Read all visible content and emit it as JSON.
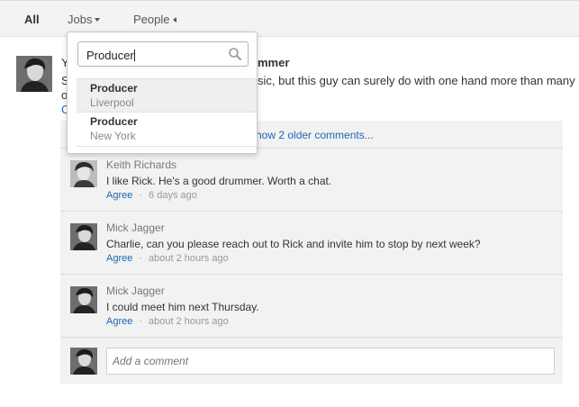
{
  "filters": {
    "all": "All",
    "jobs": "Jobs",
    "people": "People"
  },
  "post": {
    "line_y": "Y",
    "title_fragment": "mmer",
    "line_s": "S",
    "body_fragment": "sic, but this guy can surely do with one hand more than many",
    "line_o": "o",
    "line_c": "C"
  },
  "comments": {
    "older_link": "how 2 older comments...",
    "items": [
      {
        "author": "Keith Richards",
        "text": "I like Rick. He's a good drummer. Worth a chat.",
        "agree": "Agree",
        "time": "6 days ago"
      },
      {
        "author": "Mick Jagger",
        "text": "Charlie, can you please reach out to Rick and invite him to stop by next week?",
        "agree": "Agree",
        "time": "about 2 hours ago"
      },
      {
        "author": "Mick Jagger",
        "text": "I could meet him next Thursday.",
        "agree": "Agree",
        "time": "about 2 hours ago"
      }
    ],
    "meta_separator": "·",
    "add_placeholder": "Add a comment"
  },
  "dropdown": {
    "search_value": "Producer",
    "results": [
      {
        "title": "Producer",
        "location": "Liverpool"
      },
      {
        "title": "Producer",
        "location": "New York"
      }
    ]
  },
  "icons": {
    "search": "search-icon",
    "jobs_caret": "caret-down-icon",
    "people_caret": "caret-left-icon"
  },
  "colors": {
    "link": "#1e66b4",
    "topbar_bg": "#f3f3f3",
    "comments_bg": "#f2f2f2"
  }
}
